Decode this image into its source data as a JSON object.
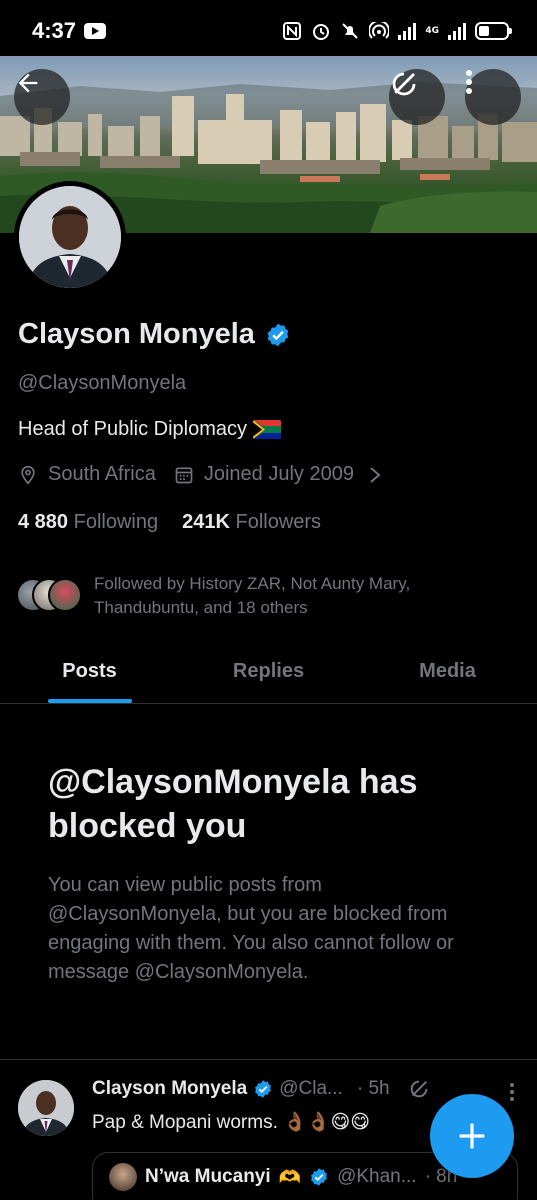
{
  "status_bar": {
    "time": "4:37",
    "network": "4G"
  },
  "banner": {
    "back_icon": "arrow-left-icon",
    "grok_icon": "grok-icon",
    "more_icon": "more-vertical-icon"
  },
  "profile": {
    "name": "Clayson Monyela",
    "handle": "@ClaysonMonyela",
    "bio": "Head of Public Diplomacy",
    "location": "South Africa",
    "joined": "Joined July 2009",
    "following_count": "4 880",
    "following_label": "Following",
    "followers_count": "241K",
    "followers_label": "Followers",
    "followed_by": "Followed by History ZAR, Not Aunty Mary, Thandubuntu, and 18 others"
  },
  "tabs": [
    {
      "label": "Posts",
      "active": true
    },
    {
      "label": "Replies",
      "active": false
    },
    {
      "label": "Media",
      "active": false
    }
  ],
  "blocked": {
    "title": "@ClaysonMonyela has blocked you",
    "description": "You can view public posts from @ClaysonMonyela, but you are blocked from engaging with them. You also cannot follow or message @ClaysonMonyela."
  },
  "post": {
    "name": "Clayson Monyela",
    "handle": "@Cla...",
    "time": "· 5h",
    "text": "Pap & Mopani worms. 👌🏾👌🏾😋😋",
    "quote": {
      "name": "N’wa Mucanyi",
      "handle": "@Khan...",
      "time": "· 8h"
    }
  },
  "colors": {
    "accent": "#1d9bf0",
    "background": "#000000",
    "text_primary": "#e7e9ea",
    "text_secondary": "#71767b"
  }
}
